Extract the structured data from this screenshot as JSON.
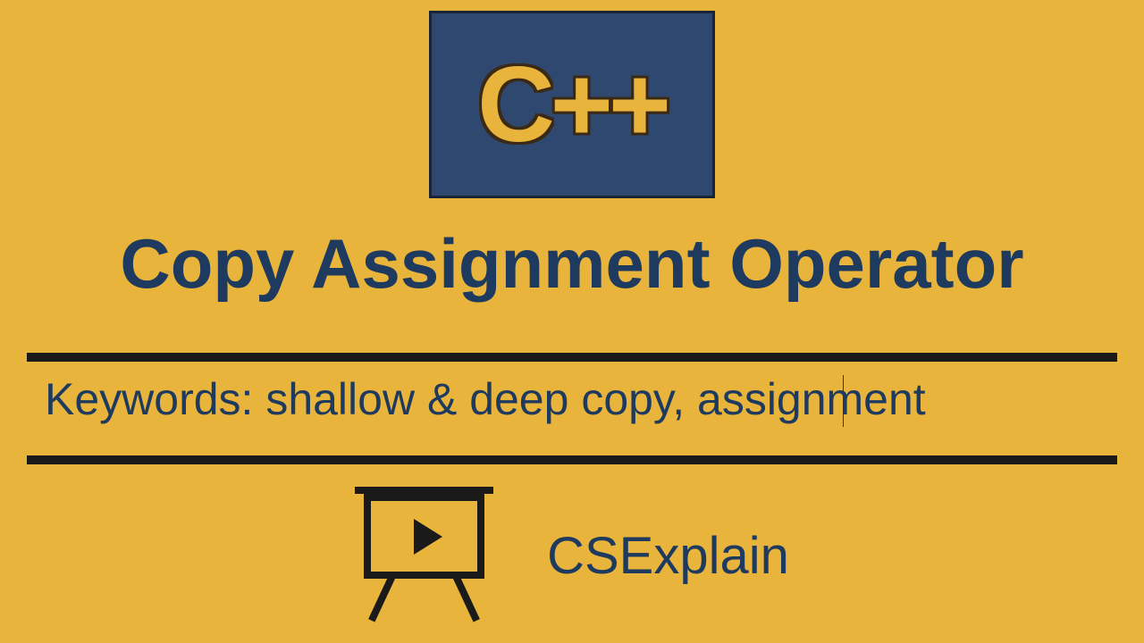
{
  "logo": {
    "text": "C++"
  },
  "title": "Copy Assignment Operator",
  "keywords": "Keywords: shallow & deep copy, assignment",
  "channel": "CSExplain"
}
